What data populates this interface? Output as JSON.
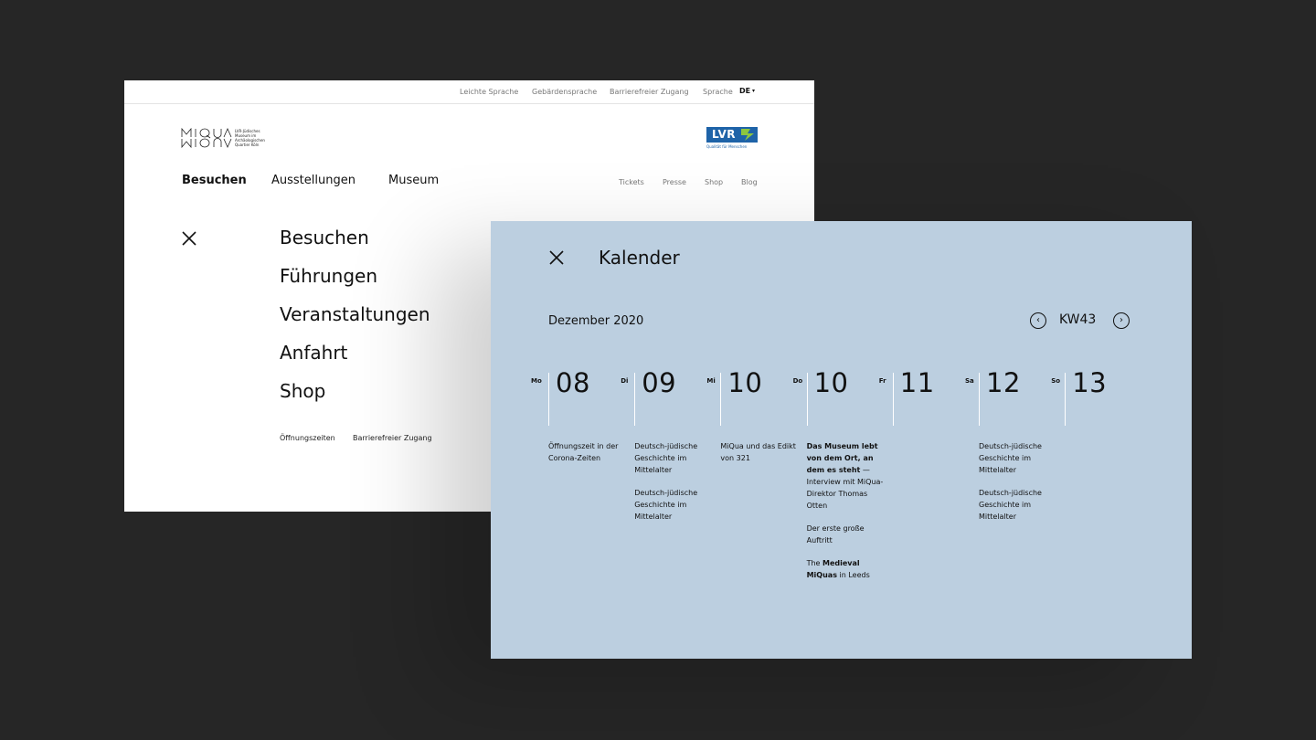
{
  "site": {
    "utility_links": [
      "Leichte Sprache",
      "Gebärdensprache",
      "Barrierefreier Zugang"
    ],
    "language_label": "Sprache",
    "language_value": "DE",
    "logo_claim": [
      "LVR-Jüdisches",
      "Museum im",
      "Archäologischen",
      "Quartier Köln"
    ],
    "lvr_logo_text": "LVR",
    "lvr_logo_subtitle": "Qualität für Menschen",
    "main_nav": [
      "Besuchen",
      "Ausstellungen",
      "Museum"
    ],
    "secondary_nav": [
      "Tickets",
      "Presse",
      "Shop",
      "Blog"
    ],
    "menu_items": [
      "Besuchen",
      "Führungen",
      "Veranstaltungen",
      "Anfahrt",
      "Shop"
    ],
    "menu_footer": [
      "Öffnungszeiten",
      "Barrierefreier Zugang"
    ]
  },
  "calendar": {
    "title": "Kalender",
    "month": "Dezember 2020",
    "week": "KW43",
    "days": [
      {
        "abbr": "Mo",
        "num": "08",
        "events": [
          {
            "parts": [
              {
                "t": "Öffnungszeit in der Corona-Zeiten",
                "b": false
              }
            ]
          }
        ]
      },
      {
        "abbr": "Di",
        "num": "09",
        "events": [
          {
            "parts": [
              {
                "t": "Deutsch-jüdische Geschichte im Mittelalter",
                "b": false
              }
            ]
          },
          {
            "parts": [
              {
                "t": "Deutsch-jüdische Geschichte im Mittelalter",
                "b": false
              }
            ]
          }
        ]
      },
      {
        "abbr": "Mi",
        "num": "10",
        "events": [
          {
            "parts": [
              {
                "t": "MiQua und das Edikt von 321",
                "b": false
              }
            ]
          }
        ]
      },
      {
        "abbr": "Do",
        "num": "10",
        "events": [
          {
            "parts": [
              {
                "t": "Das Museum lebt von dem Ort, an dem es steht",
                "b": true
              },
              {
                "t": " — Interview mit MiQua-Direktor Thomas Otten",
                "b": false
              }
            ]
          },
          {
            "parts": [
              {
                "t": "Der erste große Auftritt",
                "b": false
              }
            ]
          },
          {
            "parts": [
              {
                "t": "The ",
                "b": false
              },
              {
                "t": "Medieval MiQuas",
                "b": true
              },
              {
                "t": " in Leeds",
                "b": false
              }
            ]
          }
        ]
      },
      {
        "abbr": "Fr",
        "num": "11",
        "events": []
      },
      {
        "abbr": "Sa",
        "num": "12",
        "events": [
          {
            "parts": [
              {
                "t": "Deutsch-jüdische Geschichte im Mittelalter",
                "b": false
              }
            ]
          },
          {
            "parts": [
              {
                "t": "Deutsch-jüdische Geschichte im Mittelalter",
                "b": false
              }
            ]
          }
        ]
      },
      {
        "abbr": "So",
        "num": "13",
        "events": []
      }
    ]
  },
  "icons": {
    "close": "close-icon",
    "prev": "chevron-left-icon",
    "next": "chevron-right-icon",
    "caret": "caret-down-icon"
  },
  "colors": {
    "background": "#262626",
    "calendar_panel": "#bccfe0",
    "lvr_blue": "#1e63a8",
    "lvr_green": "#8dc63f"
  }
}
